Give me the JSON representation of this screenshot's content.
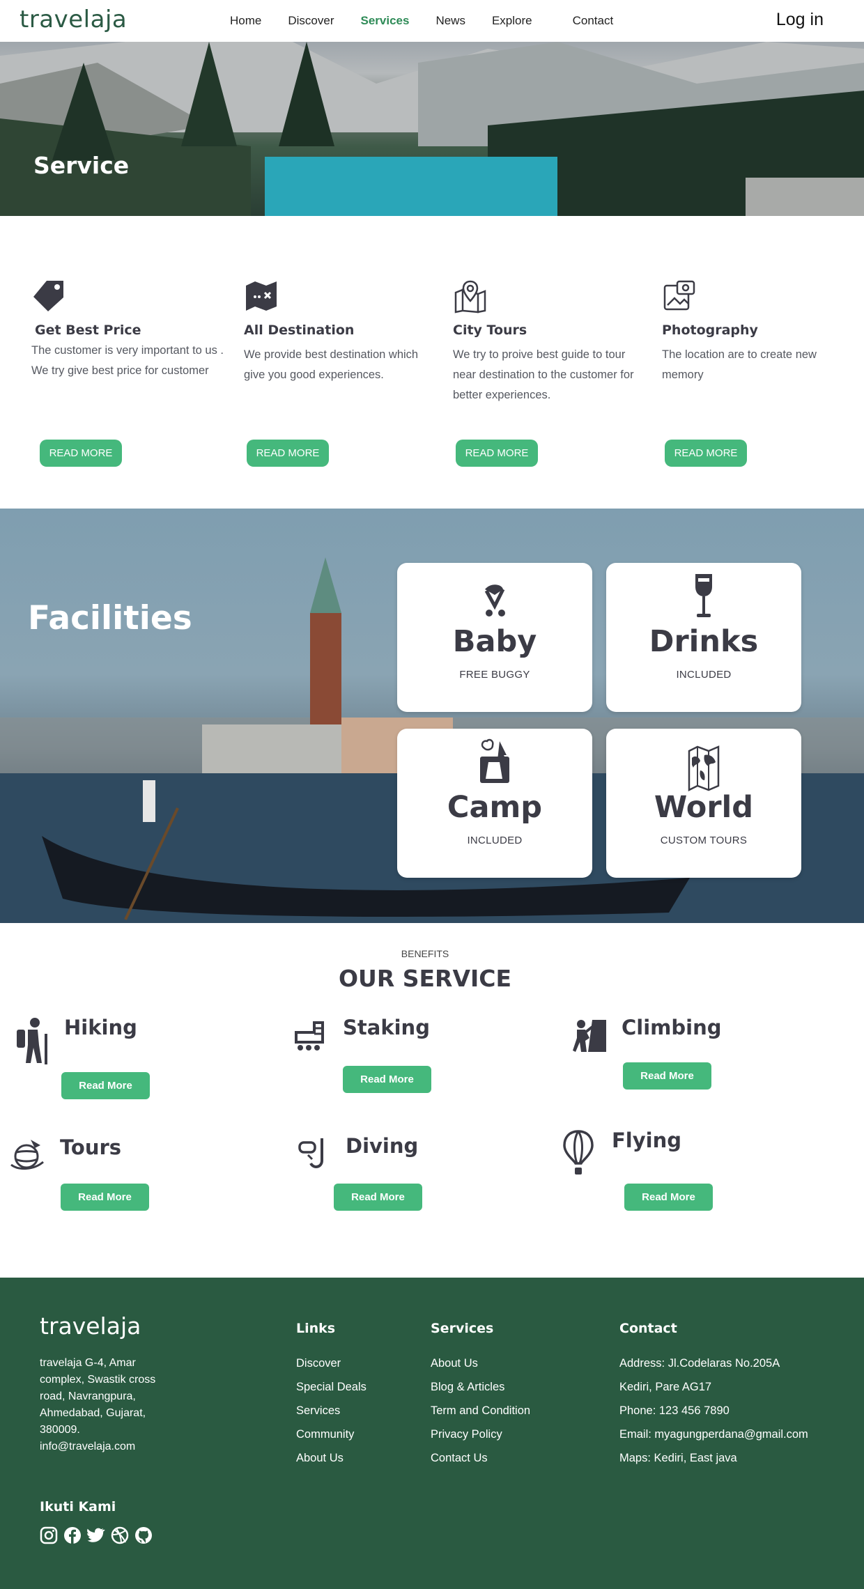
{
  "nav": {
    "logo": "travelaja",
    "links": [
      "Home",
      "Discover",
      "Services",
      "News",
      "Explore",
      "Contact"
    ],
    "active": "Services",
    "login": "Log in"
  },
  "hero": {
    "title": "Service"
  },
  "features": [
    {
      "icon": "price-tag-icon",
      "title": "Get Best Price",
      "text": "The customer is very important to us . We try give best price for customer",
      "button": "READ MORE"
    },
    {
      "icon": "map-icon",
      "title": "All Destination",
      "text": "We provide best destination which give you good experiences.",
      "button": "READ MORE"
    },
    {
      "icon": "map-pin-icon",
      "title": "City Tours",
      "text": "We try to proive best guide to tour near destination to the customer for better experiences.",
      "button": "READ MORE"
    },
    {
      "icon": "photo-icon",
      "title": "Photography",
      "text": "The location are to create new memory",
      "button": "READ MORE"
    }
  ],
  "facilities": {
    "title": "Facilities",
    "cards": [
      {
        "icon": "stroller-icon",
        "title": "Baby",
        "subtitle": "FREE BUGGY"
      },
      {
        "icon": "wine-glass-icon",
        "title": "Drinks",
        "subtitle": "INCLUDED"
      },
      {
        "icon": "camp-icon",
        "title": "Camp",
        "subtitle": "INCLUDED"
      },
      {
        "icon": "world-map-icon",
        "title": "World",
        "subtitle": "CUSTOM TOURS"
      }
    ]
  },
  "benefits": {
    "label": "BENEFITS",
    "title": "OUR SERVICE",
    "items": [
      {
        "icon": "hiking-icon",
        "title": "Hiking",
        "button": "Read More"
      },
      {
        "icon": "skating-icon",
        "title": "Staking",
        "button": "Read More"
      },
      {
        "icon": "climbing-icon",
        "title": "Climbing",
        "button": "Read More"
      },
      {
        "icon": "globe-plane-icon",
        "title": "Tours",
        "button": "Read More"
      },
      {
        "icon": "snorkel-icon",
        "title": "Diving",
        "button": "Read More"
      },
      {
        "icon": "hot-air-balloon-icon",
        "title": "Flying",
        "button": "Read More"
      }
    ]
  },
  "footer": {
    "logo": "travelaja",
    "address": "travelaja G-4, Amar complex, Swastik cross road, Navrangpura, Ahmedabad, Gujarat, 380009.",
    "email": "info@travelaja.com",
    "links": {
      "title": "Links",
      "items": [
        "Discover",
        "Special Deals",
        "Services",
        "Community",
        "About Us"
      ]
    },
    "services": {
      "title": "Services",
      "items": [
        "About Us",
        "Blog & Articles",
        "Term and Condition",
        "Privacy Policy",
        "Contact Us"
      ]
    },
    "contact": {
      "title": "Contact",
      "items": [
        "Address: Jl.Codelaras No.205A",
        "Kediri, Pare AG17",
        "Phone: 123 456 7890",
        "Email: myagungperdana@gmail.com",
        "Maps: Kediri, East java"
      ]
    },
    "follow": "Ikuti Kami",
    "socials": [
      "instagram-icon",
      "facebook-icon",
      "twitter-icon",
      "dribbble-icon",
      "github-icon"
    ]
  },
  "colors": {
    "brand": "#2b5a44",
    "accent": "#45b87c",
    "active_nav": "#2e8b57",
    "footer_bg": "#2a5a41",
    "text_dark": "#3b3b45"
  }
}
